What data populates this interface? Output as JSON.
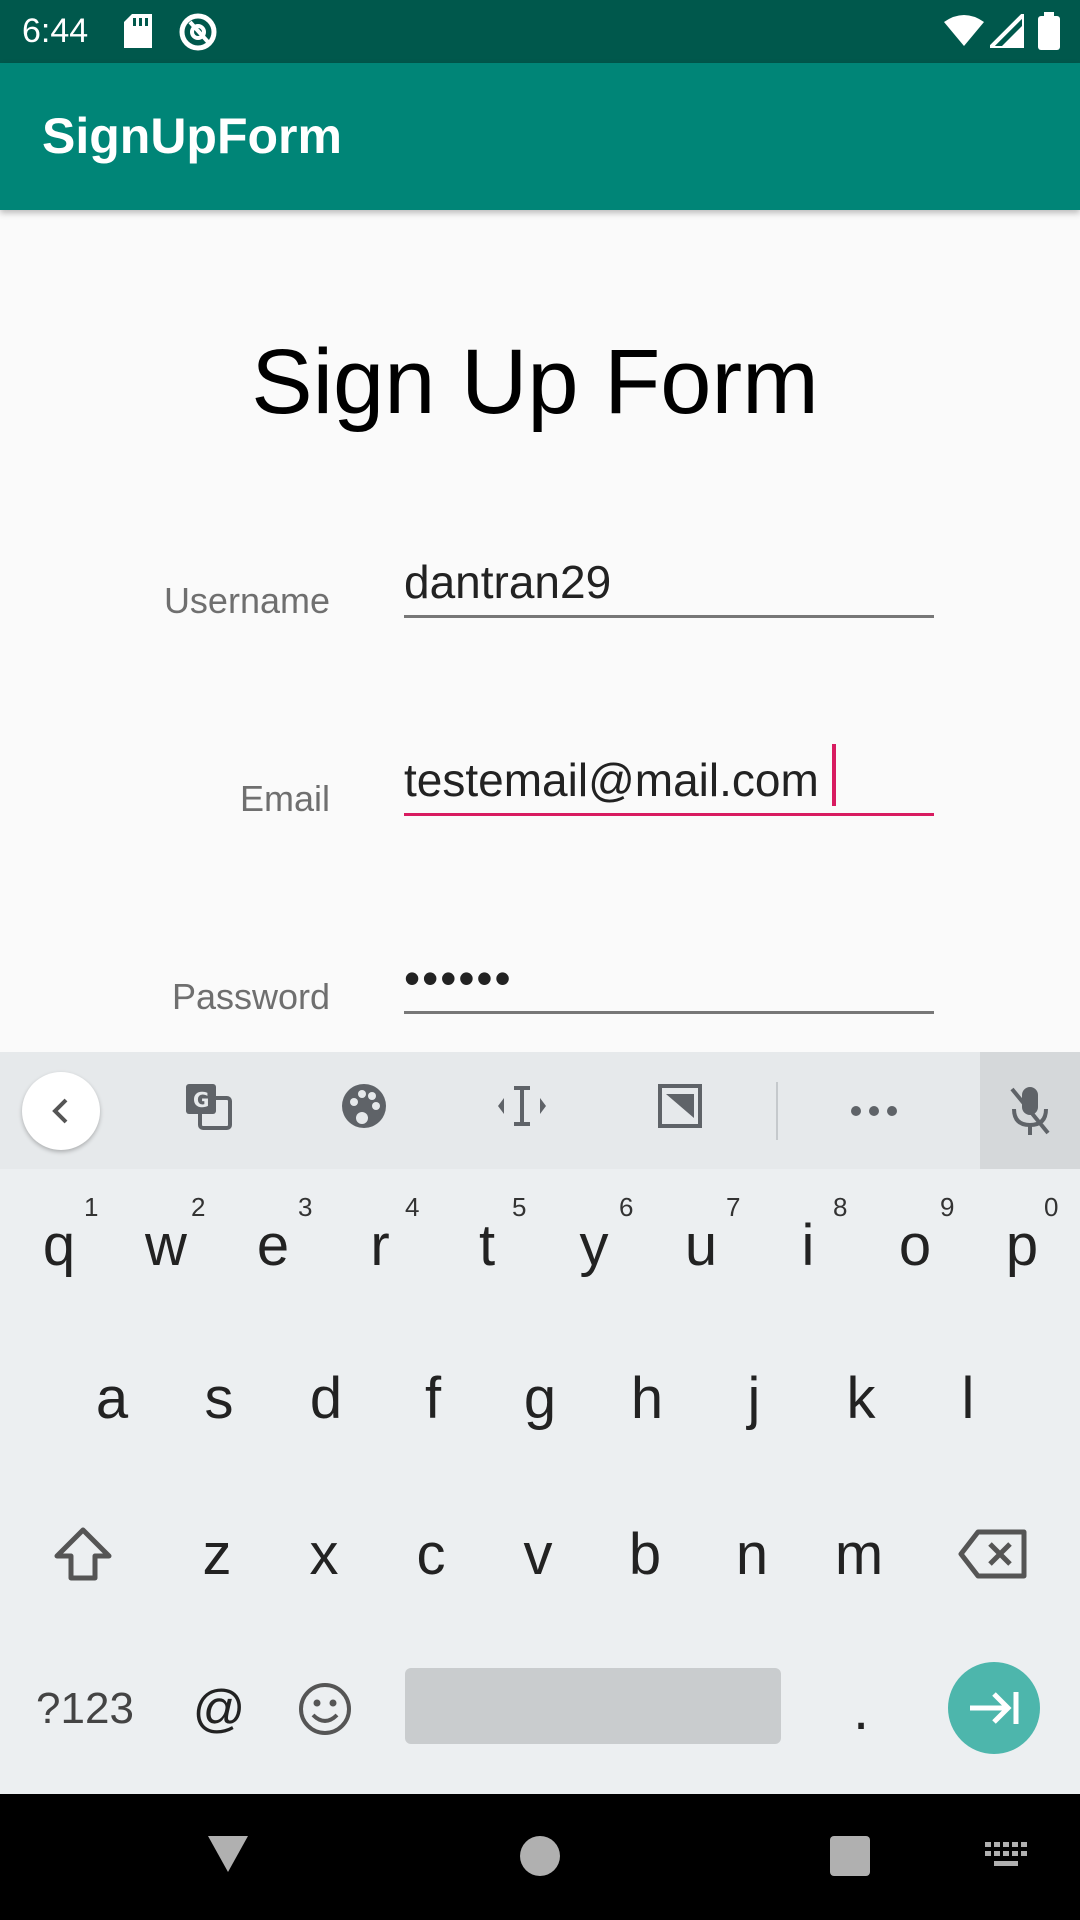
{
  "status_bar": {
    "time": "6:44",
    "icons": [
      "sd-card-icon",
      "at-ring-icon",
      "wifi-icon",
      "signal-icon",
      "battery-icon"
    ]
  },
  "app_bar": {
    "title": "SignUpForm"
  },
  "form": {
    "title": "Sign Up Form",
    "fields": [
      {
        "label": "Username",
        "value": "dantran29"
      },
      {
        "label": "Email",
        "value": "testemail@mail.com",
        "focused": true
      },
      {
        "label": "Password",
        "value": "••••••"
      }
    ]
  },
  "keyboard": {
    "toolbar_icons": [
      "chevron-left-icon",
      "translate-icon",
      "palette-icon",
      "text-cursor-icon",
      "clipboard-icon",
      "more-icon",
      "mic-off-icon"
    ],
    "row1": [
      "q",
      "w",
      "e",
      "r",
      "t",
      "y",
      "u",
      "i",
      "o",
      "p"
    ],
    "row1_hints": [
      "1",
      "2",
      "3",
      "4",
      "5",
      "6",
      "7",
      "8",
      "9",
      "0"
    ],
    "row2": [
      "a",
      "s",
      "d",
      "f",
      "g",
      "h",
      "j",
      "k",
      "l"
    ],
    "row3": [
      "z",
      "x",
      "c",
      "v",
      "b",
      "n",
      "m"
    ],
    "bottom": {
      "symbols": "?123",
      "at": "@",
      "period": "."
    },
    "accent_color": "#4db6ac"
  },
  "colors": {
    "status_bar": "#00584c",
    "app_bar": "#008577",
    "focus_underline": "#d81b60"
  }
}
